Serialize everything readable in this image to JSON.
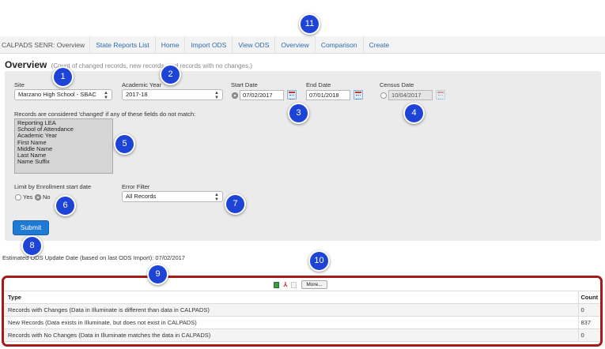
{
  "nav": {
    "app_title": "CALPADS SENR: Overview",
    "links": [
      "State Reports List",
      "Home",
      "Import ODS",
      "View ODS",
      "Overview",
      "Comparison",
      "Create"
    ]
  },
  "heading": {
    "title": "Overview",
    "subtitle": "(Count of changed records, new records, and records with no changes.)"
  },
  "form": {
    "site": {
      "label": "Site",
      "value": "Marzano High School - SBAC"
    },
    "academic_year": {
      "label": "Academic Year",
      "value": "2017-18"
    },
    "start_date": {
      "label": "Start Date",
      "value": "07/02/2017"
    },
    "end_date": {
      "label": "End Date",
      "value": "07/01/2018"
    },
    "census_date": {
      "label": "Census Date",
      "value": "10/04/2017"
    },
    "fields_label": "Records are considered 'changed' if any of these fields do not match:",
    "fields": [
      "Reporting LEA",
      "School of Attendance",
      "Academic Year",
      "First Name",
      "Middle Name",
      "Last Name",
      "Name Suffix"
    ],
    "limit": {
      "label": "Limit by Enrollment start date",
      "yes": "Yes",
      "no": "No",
      "selected": "No"
    },
    "error_filter": {
      "label": "Error Filter",
      "value": "All Records"
    },
    "submit_label": "Submit"
  },
  "estimated_text": "Estimated ODS Update Date (based on last ODS Import): 07/02/2017",
  "results": {
    "more_label": "More...",
    "columns": [
      "Type",
      "Count"
    ],
    "rows": [
      {
        "type": "Records with Changes (Data in Illuminate is different than data in CALPADS)",
        "count": "0"
      },
      {
        "type": "New Records (Data exists in Illuminate, but does not exist in CALPADS)",
        "count": "837"
      },
      {
        "type": "Records with No Changes (Data in Illuminate matches the data in CALPADS)",
        "count": "0"
      }
    ]
  },
  "callouts": [
    "1",
    "2",
    "3",
    "4",
    "5",
    "6",
    "7",
    "8",
    "9",
    "10",
    "11"
  ],
  "colors": {
    "callout": "#1d44d6",
    "highlight_border": "#a31b1b",
    "button": "#1f7ad4",
    "link": "#2b6cb0"
  }
}
